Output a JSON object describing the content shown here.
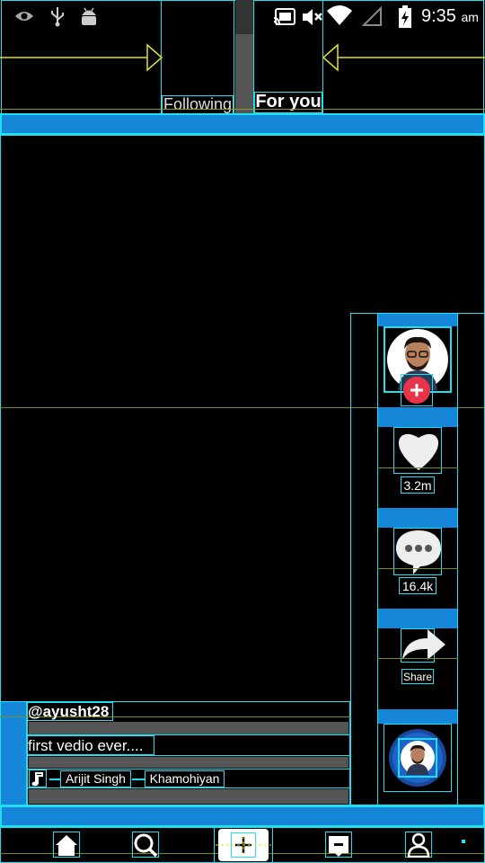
{
  "status_bar": {
    "time": "9:35",
    "ampm": "am",
    "left_icons": [
      "eye-icon",
      "usb-icon",
      "android-icon"
    ],
    "right_icons": [
      "cast-icon",
      "mute-icon",
      "wifi-icon",
      "signal-icon",
      "battery-charging-icon"
    ]
  },
  "tabs": {
    "following": "Following",
    "for_you": "For you"
  },
  "actions": {
    "likes": "3.2m",
    "comments": "16.4k",
    "share": "Share"
  },
  "post": {
    "username": "@ayusht28",
    "caption": "first vedio ever....",
    "music_artist": "Arijit Singh",
    "music_title": "Khamohiyan"
  },
  "nav": [
    "home-icon",
    "search-icon",
    "add-icon",
    "inbox-icon",
    "profile-icon"
  ],
  "colors": {
    "accent_outline": "#1ee0f0",
    "band_blue": "#1686d8",
    "follow_red": "#e8334a",
    "arrow_yellow": "#e6e619"
  }
}
